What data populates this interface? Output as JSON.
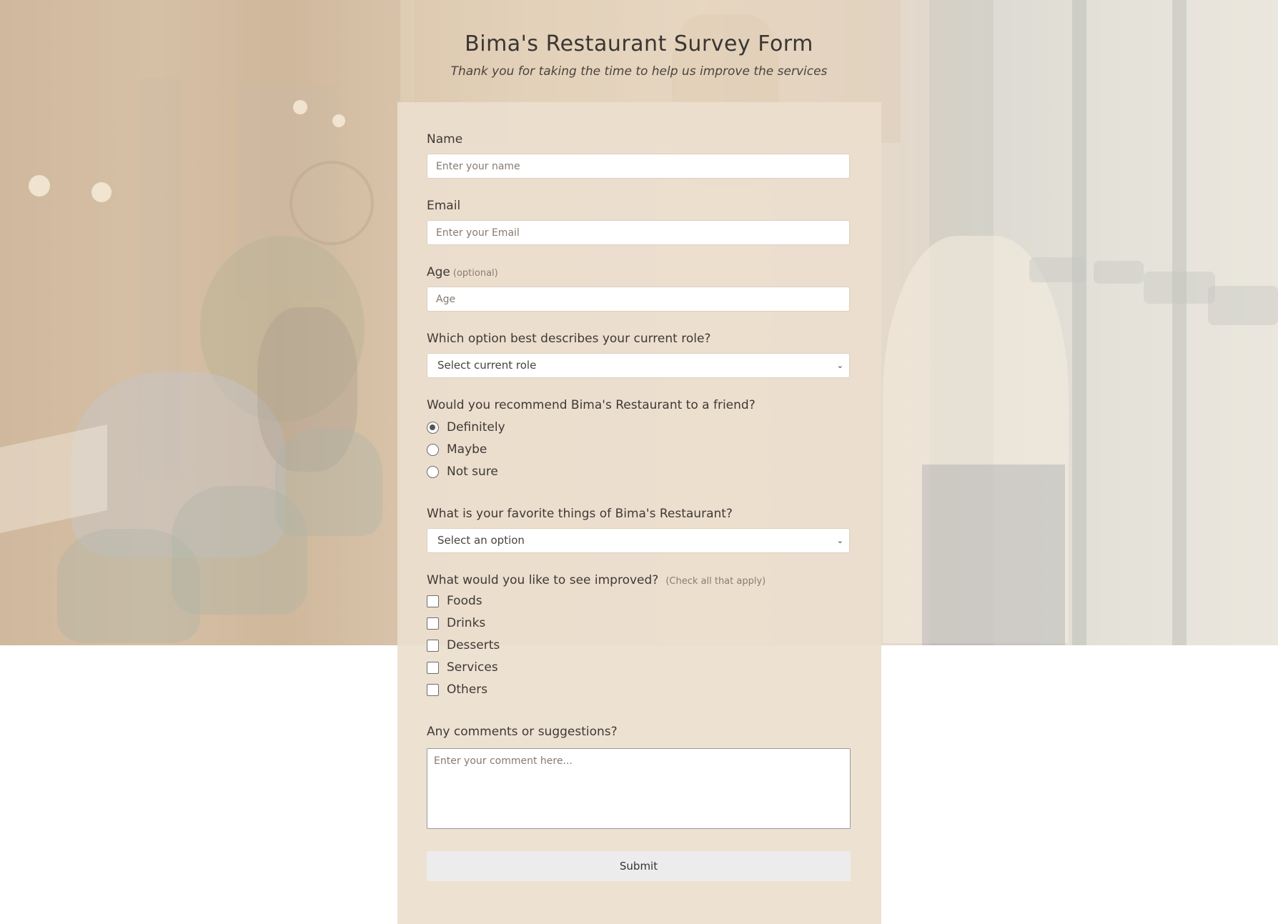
{
  "header": {
    "title": "Bima's Restaurant Survey Form",
    "subtitle": "Thank you for taking the time to help us improve the services"
  },
  "form": {
    "name": {
      "label": "Name",
      "placeholder": "Enter your name"
    },
    "email": {
      "label": "Email",
      "placeholder": "Enter your Email"
    },
    "age": {
      "label": "Age",
      "hint": "(optional)",
      "placeholder": "Age"
    },
    "role": {
      "label": "Which option best describes your current role?",
      "selected": "Select current role"
    },
    "recommend": {
      "label": "Would you recommend Bima's Restaurant to a friend?",
      "options": [
        "Definitely",
        "Maybe",
        "Not sure"
      ],
      "selected": "Definitely"
    },
    "favorite": {
      "label": "What is your favorite things of Bima's Restaurant?",
      "selected": "Select an option"
    },
    "improve": {
      "label": "What would you like to see improved?",
      "hint": "(Check all that apply)",
      "options": [
        "Foods",
        "Drinks",
        "Desserts",
        "Services",
        "Others"
      ]
    },
    "comments": {
      "label": "Any comments or suggestions?",
      "placeholder": "Enter your comment here..."
    },
    "submit_label": "Submit"
  },
  "icons": {
    "select_arrow": "chevron-down-icon"
  }
}
